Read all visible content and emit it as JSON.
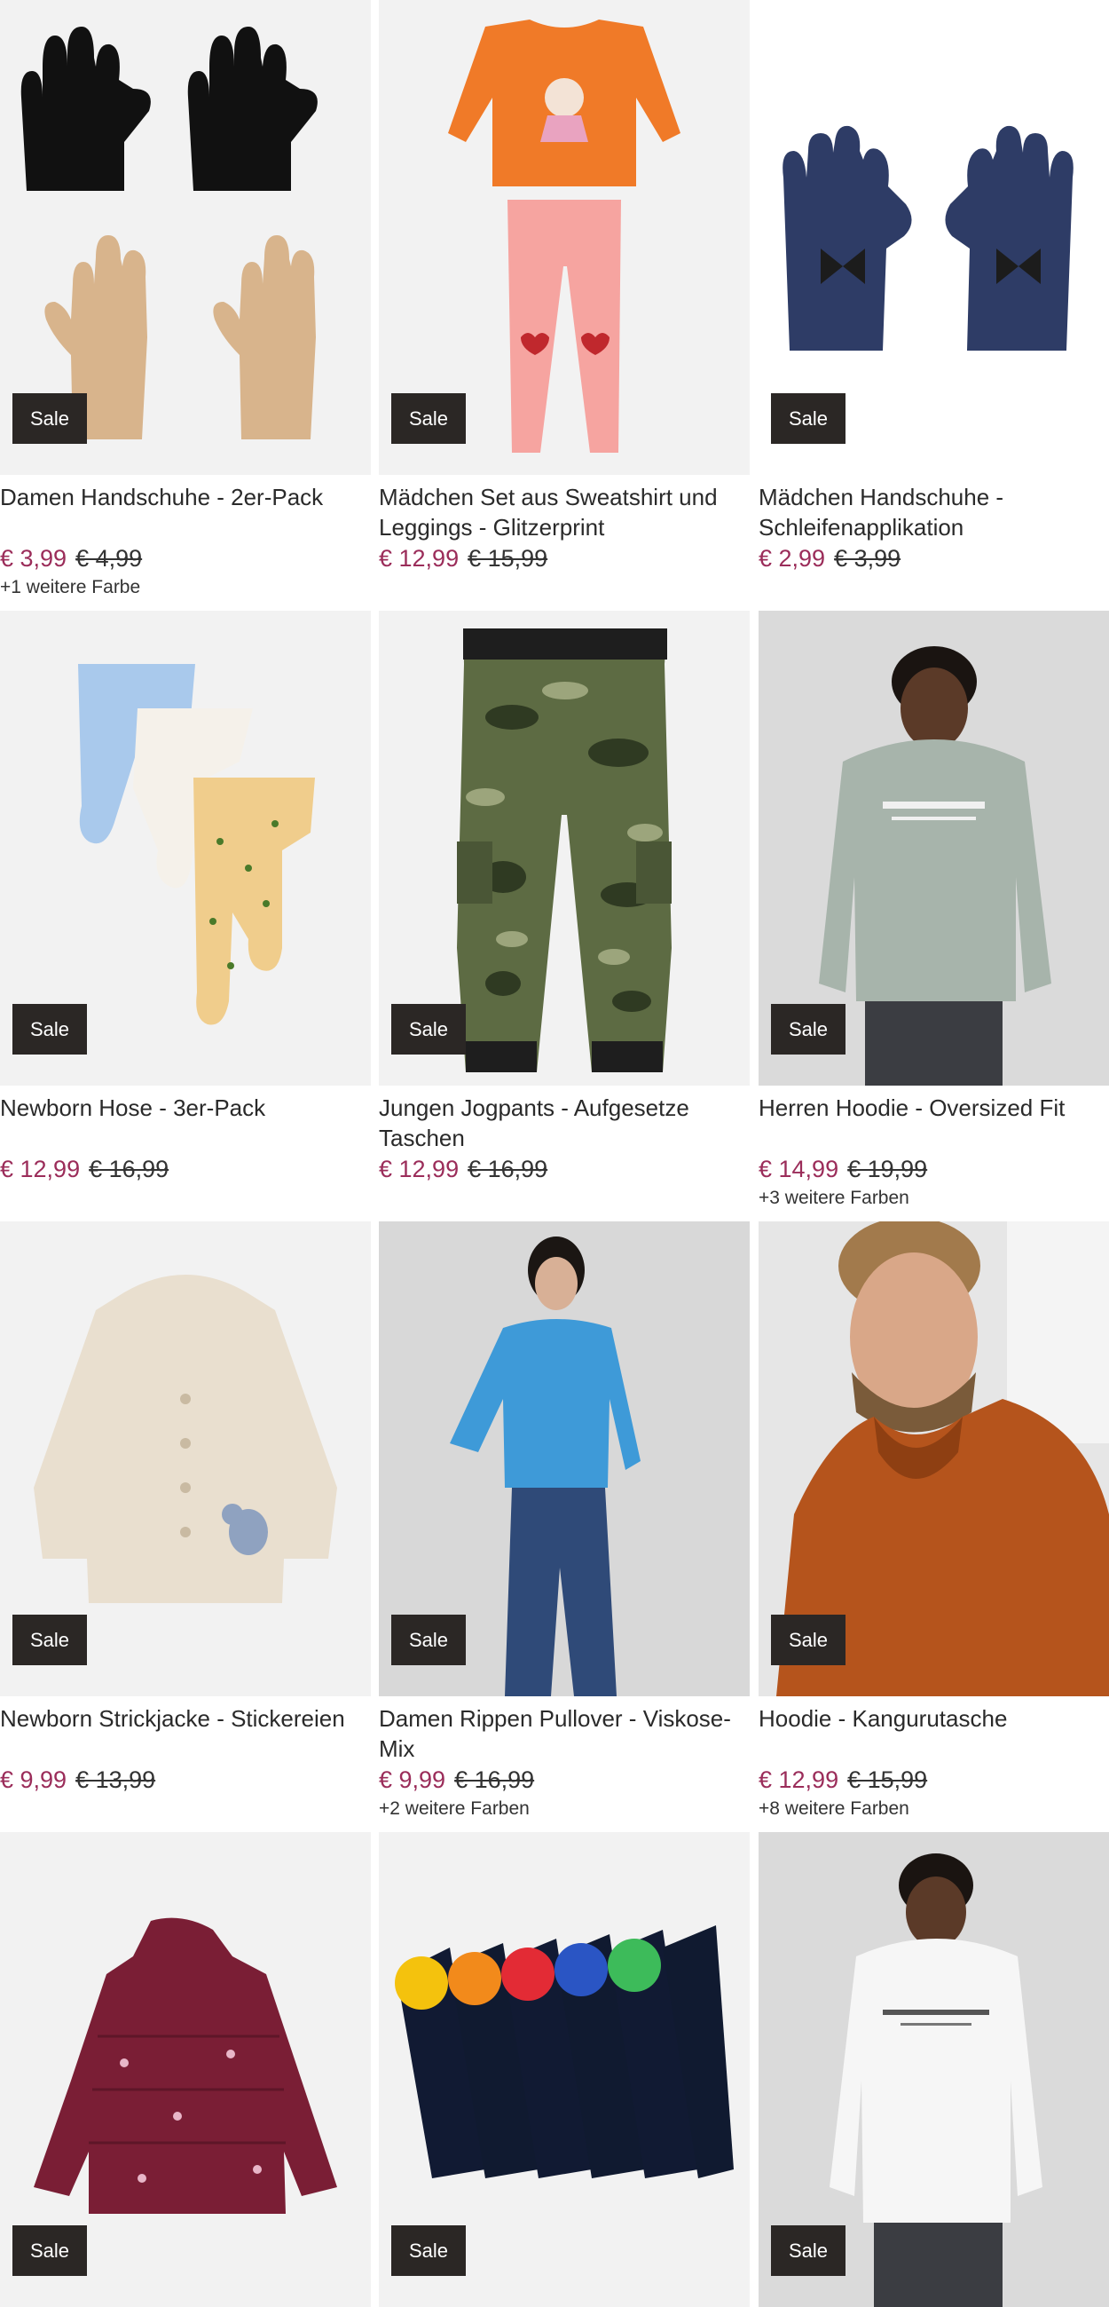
{
  "products": [
    {
      "title": "Damen Handschuhe - 2er-Pack",
      "price": "€ 3,99",
      "old_price": "€ 4,99",
      "badge": "Sale",
      "more_colors": "+1 weitere Farbe",
      "bg": "#f2f2f2"
    },
    {
      "title": "Mädchen Set aus Sweatshirt und Leggings - Glitzerprint",
      "price": "€ 12,99",
      "old_price": "€ 15,99",
      "badge": "Sale",
      "more_colors": "",
      "bg": "#f2f2f2"
    },
    {
      "title": "Mädchen Handschuhe - Schleifenapplikation",
      "price": "€ 2,99",
      "old_price": "€ 3,99",
      "badge": "Sale",
      "more_colors": "",
      "bg": "#ffffff"
    },
    {
      "title": "Newborn Hose - 3er-Pack",
      "price": "€ 12,99",
      "old_price": "€ 16,99",
      "badge": "Sale",
      "more_colors": "",
      "bg": "#f2f2f2"
    },
    {
      "title": "Jungen Jogpants - Aufgesetze Taschen",
      "price": "€ 12,99",
      "old_price": "€ 16,99",
      "badge": "Sale",
      "more_colors": "",
      "bg": "#f2f2f2"
    },
    {
      "title": "Herren Hoodie - Oversized Fit",
      "price": "€ 14,99",
      "old_price": "€ 19,99",
      "badge": "Sale",
      "more_colors": "+3 weitere Farben",
      "bg": "#dadada"
    },
    {
      "title": "Newborn Strickjacke - Stickereien",
      "price": "€ 9,99",
      "old_price": "€ 13,99",
      "badge": "Sale",
      "more_colors": "",
      "bg": "#f2f2f2"
    },
    {
      "title": "Damen Rippen Pullover - Viskose-Mix",
      "price": "€ 9,99",
      "old_price": "€ 16,99",
      "badge": "Sale",
      "more_colors": "+2 weitere Farben",
      "bg": "#d8d8d8"
    },
    {
      "title": "Hoodie - Kangurutasche",
      "price": "€ 12,99",
      "old_price": "€ 15,99",
      "badge": "Sale",
      "more_colors": "+8 weitere Farben",
      "bg": "#e6e6e6"
    },
    {
      "title": "",
      "price": "",
      "old_price": "",
      "badge": "Sale",
      "more_colors": "",
      "bg": "#f2f2f2"
    },
    {
      "title": "",
      "price": "",
      "old_price": "",
      "badge": "Sale",
      "more_colors": "",
      "bg": "#f2f2f2"
    },
    {
      "title": "",
      "price": "",
      "old_price": "",
      "badge": "Sale",
      "more_colors": "",
      "bg": "#dadada"
    }
  ],
  "colors": {
    "price": "#9b2d5a",
    "badge_bg": "#2b2725"
  }
}
